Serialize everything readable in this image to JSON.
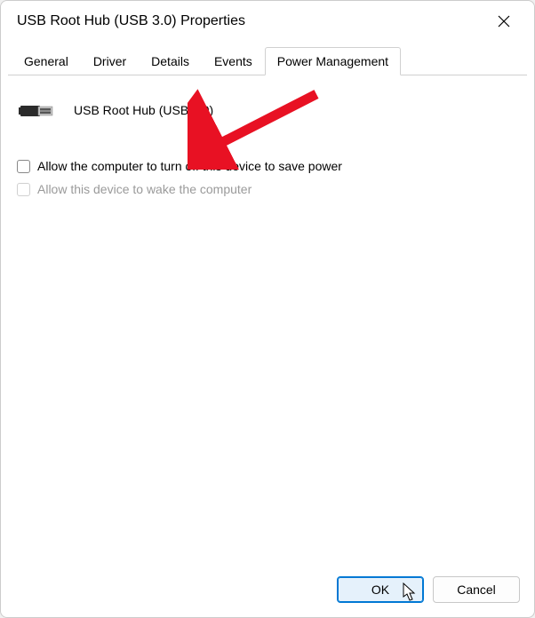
{
  "window": {
    "title": "USB Root Hub (USB 3.0) Properties"
  },
  "tabs": {
    "general": "General",
    "driver": "Driver",
    "details": "Details",
    "events": "Events",
    "power_management": "Power Management"
  },
  "device": {
    "name": "USB Root Hub (USB 3.0)"
  },
  "checkboxes": {
    "allow_turn_off": "Allow the computer to turn off this device to save power",
    "allow_wake": "Allow this device to wake the computer"
  },
  "buttons": {
    "ok": "OK",
    "cancel": "Cancel"
  },
  "colors": {
    "accent": "#0078d4",
    "arrow": "#e81123"
  }
}
